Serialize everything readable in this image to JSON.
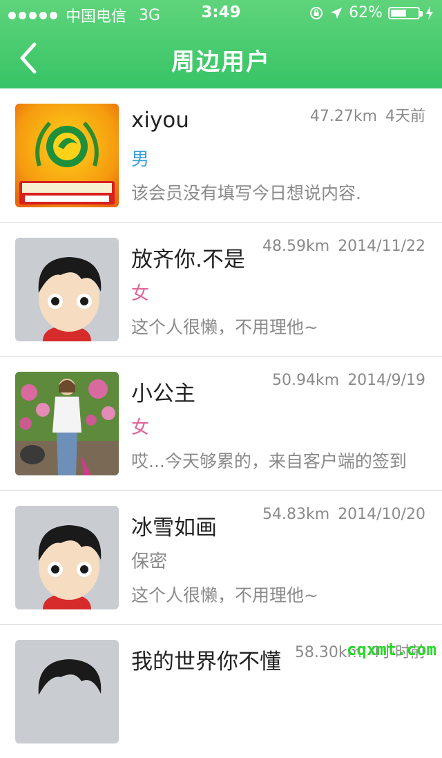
{
  "status_bar": {
    "carrier": "中国电信",
    "network": "3G",
    "time": "3:49",
    "battery_percent": "62%",
    "battery_level": 0.62
  },
  "nav": {
    "title": "周边用户",
    "back_icon": "chevron-left-icon"
  },
  "colors": {
    "header_green": "#3fc76b",
    "male_blue": "#3aa0d8",
    "female_pink": "#e2659a",
    "secret_gray": "#8a8a8a"
  },
  "users": [
    {
      "name": "xiyou",
      "distance": "47.27km",
      "time": "4天前",
      "gender": "男",
      "gender_type": "male",
      "signature": "该会员没有填写今日想说内容.",
      "avatar": "logo"
    },
    {
      "name": "放齐你.不是",
      "distance": "48.59km",
      "time": "2014/11/22",
      "gender": "女",
      "gender_type": "female",
      "signature": "这个人很懒，不用理他~",
      "avatar": "default"
    },
    {
      "name": "小公主",
      "distance": "50.94km",
      "time": "2014/9/19",
      "gender": "女",
      "gender_type": "female",
      "signature": "哎...今天够累的，来自客户端的签到",
      "avatar": "photo"
    },
    {
      "name": "冰雪如画",
      "distance": "54.83km",
      "time": "2014/10/20",
      "gender": "保密",
      "gender_type": "secret",
      "signature": "这个人很懒，不用理他~",
      "avatar": "default"
    },
    {
      "name": "我的世界你不懂",
      "distance": "58.30km",
      "time": "4小时前",
      "gender": "",
      "gender_type": "",
      "signature": "",
      "avatar": "default"
    }
  ],
  "watermark": "cqxmt.com"
}
